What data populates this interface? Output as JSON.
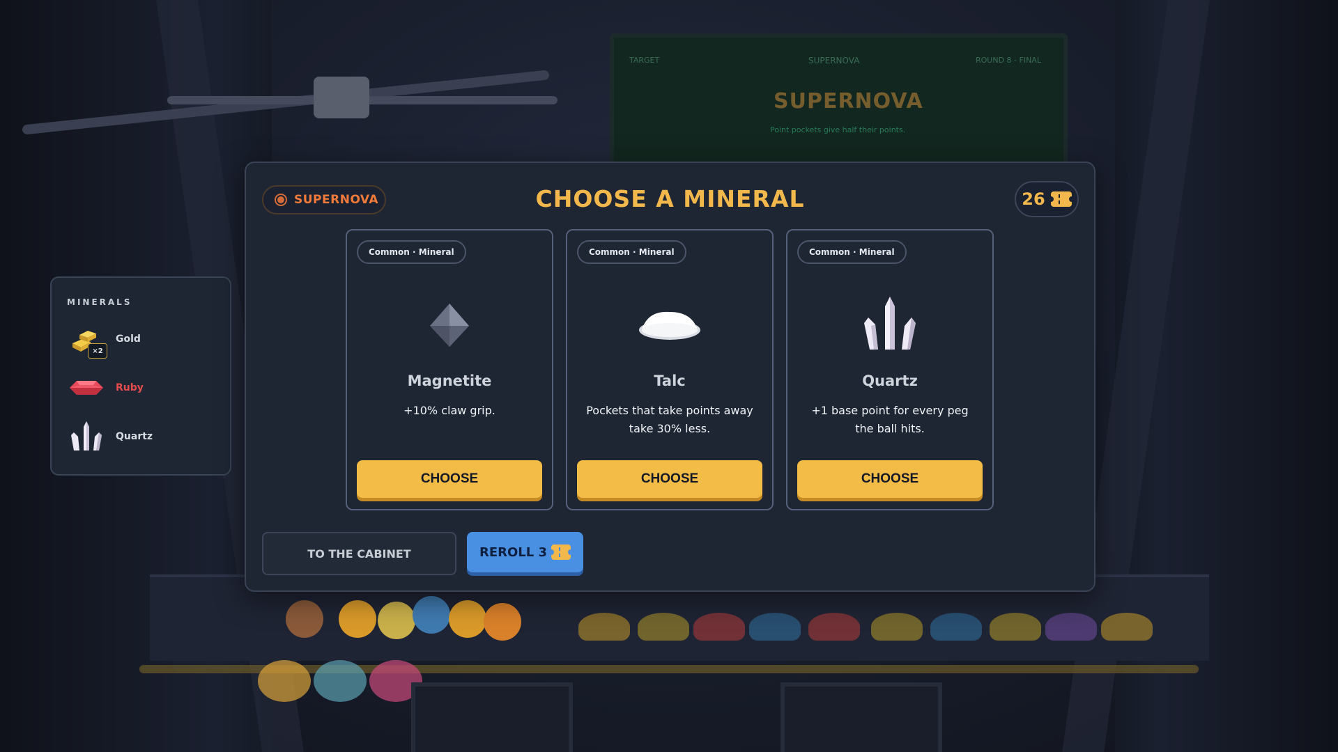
{
  "background": {
    "screen_target_label": "TARGET",
    "screen_badge": "SUPERNOVA",
    "screen_round": "ROUND 8 - FINAL",
    "screen_title": "SUPERNOVA",
    "screen_sub": "Point pockets give half their points."
  },
  "header": {
    "badge_label": "SUPERNOVA",
    "title": "CHOOSE A MINERAL",
    "tickets": "26"
  },
  "cards": [
    {
      "rarity": "Common · Mineral",
      "name": "Magnetite",
      "description": "+10% claw grip.",
      "button": "CHOOSE",
      "icon": "magnetite-icon"
    },
    {
      "rarity": "Common · Mineral",
      "name": "Talc",
      "description": "Pockets that take points away take 30% less.",
      "button": "CHOOSE",
      "icon": "talc-icon"
    },
    {
      "rarity": "Common · Mineral",
      "name": "Quartz",
      "description": "+1 base point for every peg the ball hits.",
      "button": "CHOOSE",
      "icon": "quartz-icon"
    }
  ],
  "footer": {
    "cabinet_label": "TO THE CABINET",
    "reroll_label": "REROLL 3"
  },
  "minerals_panel": {
    "heading": "MINERALS",
    "items": [
      {
        "label": "Gold",
        "badge": "×2",
        "color": "#e6b83a"
      },
      {
        "label": "Ruby",
        "color": "#e74c4c"
      },
      {
        "label": "Quartz",
        "color": "#e8e4f0"
      }
    ]
  },
  "colors": {
    "accent": "#f2b84b",
    "supernova": "#f07a3a",
    "reroll": "#4a90e2"
  }
}
